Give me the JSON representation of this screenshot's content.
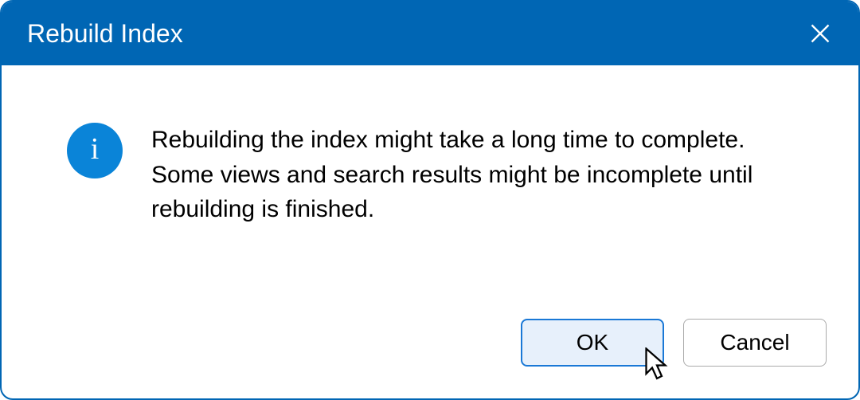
{
  "dialog": {
    "title": "Rebuild Index",
    "message": "Rebuilding the index might take a long time to complete. Some views and search results might be incomplete until rebuilding is finished.",
    "info_glyph": "i",
    "buttons": {
      "ok": "OK",
      "cancel": "Cancel"
    }
  },
  "colors": {
    "accent": "#0066b4",
    "info_icon": "#0a84d8"
  }
}
